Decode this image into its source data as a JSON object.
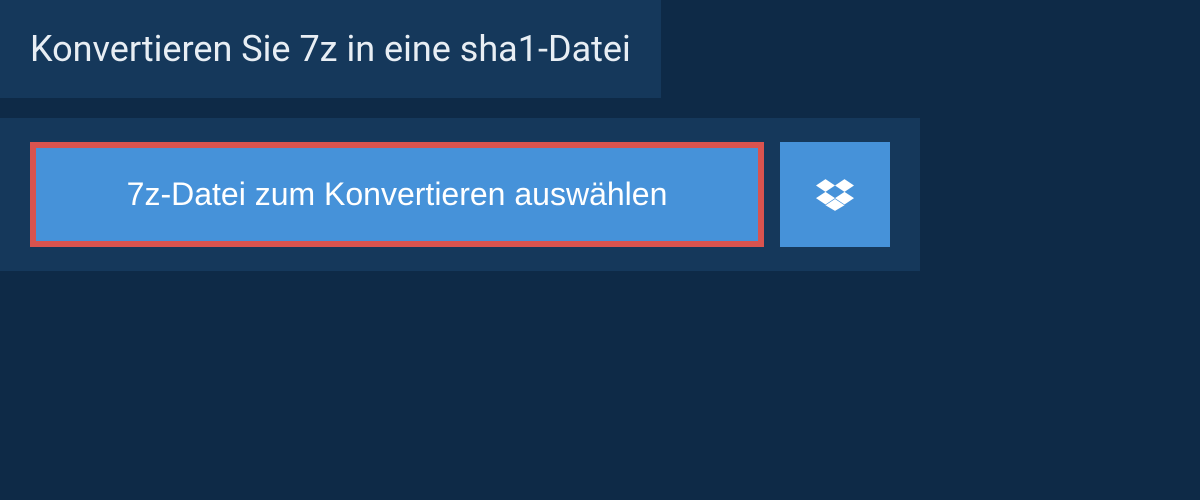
{
  "header": {
    "title": "Konvertieren Sie 7z in eine sha1-Datei"
  },
  "upload": {
    "select_label": "7z-Datei zum Konvertieren auswählen",
    "dropbox_icon": "dropbox"
  }
}
